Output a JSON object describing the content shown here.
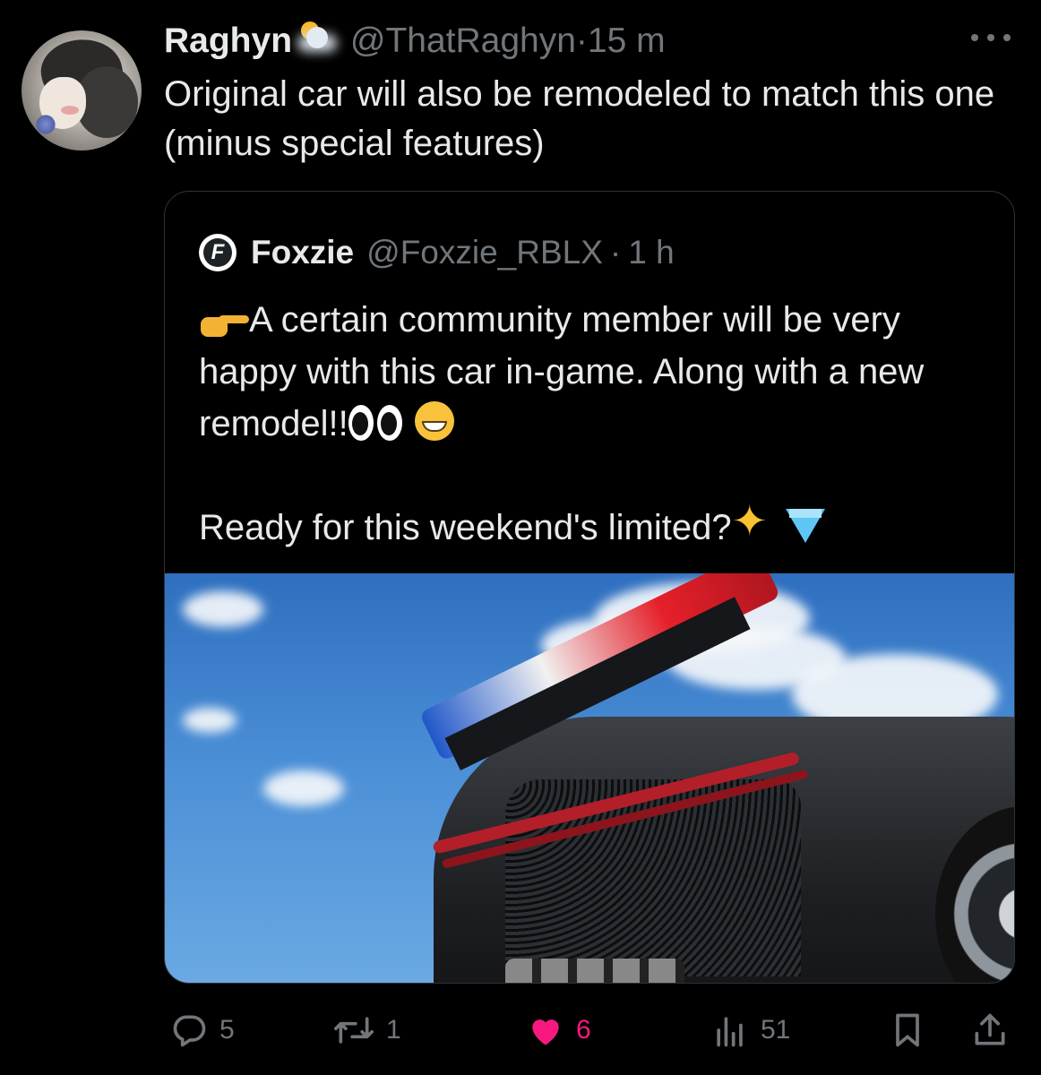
{
  "tweet": {
    "display_name": "Raghyn",
    "name_emoji": "weather-sun-behind-cloud-icon",
    "handle": "@ThatRaghyn",
    "separator": "·",
    "time": "15 m",
    "text": "Original car will also be remodeled to match this one (minus special features)"
  },
  "quote": {
    "display_name": "Foxzie",
    "logo_letter": "F",
    "handle": "@Foxzie_RBLX",
    "separator": "·",
    "time": "1 h",
    "line1": "A certain community member will be very happy with this car in-game. Along with a new remodel!!",
    "line2": "Ready for this weekend's limited?",
    "emojis": [
      "backhand-index-pointing-right-icon",
      "eyes-icon",
      "grinning-face-icon",
      "glowing-star-icon",
      "gem-icon"
    ],
    "media": "car-rear-spoiler-image"
  },
  "actions": {
    "replies": "5",
    "reposts": "1",
    "likes": "6",
    "views": "51"
  },
  "colors": {
    "background": "#000000",
    "text": "#e7e9ea",
    "muted": "#71767b",
    "border": "#2f3336",
    "like": "#f91880"
  }
}
